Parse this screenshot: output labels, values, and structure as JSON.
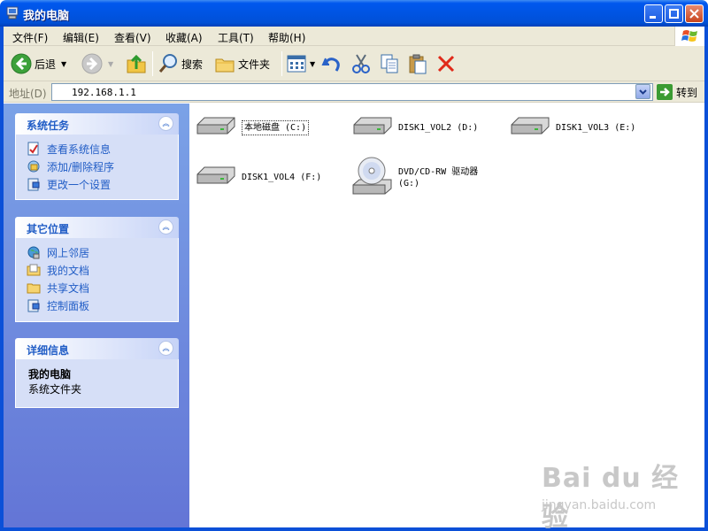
{
  "window": {
    "title": "我的电脑"
  },
  "menu": [
    {
      "label": "文件(F)"
    },
    {
      "label": "编辑(E)"
    },
    {
      "label": "查看(V)"
    },
    {
      "label": "收藏(A)"
    },
    {
      "label": "工具(T)"
    },
    {
      "label": "帮助(H)"
    }
  ],
  "toolbar": {
    "back_label": "后退",
    "search_label": "搜索",
    "folders_label": "文件夹"
  },
  "address": {
    "label": "地址(D)",
    "value": "192.168.1.1",
    "go_label": "转到"
  },
  "task_pane": {
    "system_tasks": {
      "title": "系统任务",
      "items": [
        {
          "label": "查看系统信息",
          "icon": "system-info-icon"
        },
        {
          "label": "添加/删除程序",
          "icon": "add-remove-programs-icon"
        },
        {
          "label": "更改一个设置",
          "icon": "control-panel-icon"
        }
      ]
    },
    "other_places": {
      "title": "其它位置",
      "items": [
        {
          "label": "网上邻居",
          "icon": "network-places-icon"
        },
        {
          "label": "我的文档",
          "icon": "my-documents-icon"
        },
        {
          "label": "共享文档",
          "icon": "shared-folder-icon"
        },
        {
          "label": "控制面板",
          "icon": "control-panel-icon"
        }
      ]
    },
    "details": {
      "title": "详细信息",
      "name": "我的电脑",
      "description": "系统文件夹"
    }
  },
  "drives": [
    {
      "label": "本地磁盘 (C:)",
      "icon": "hard-disk-icon"
    },
    {
      "label": "DISK1_VOL2 (D:)",
      "icon": "hard-disk-icon"
    },
    {
      "label": "DISK1_VOL3 (E:)",
      "icon": "hard-disk-icon"
    },
    {
      "label": "DISK1_VOL4 (F:)",
      "icon": "hard-disk-icon"
    },
    {
      "label_line1": "DVD/CD-RW 驱动器",
      "label_line2": "(G:)",
      "icon": "dvd-drive-icon"
    }
  ],
  "watermark": {
    "main": "Bai du 经验",
    "sub": "jingyan.baidu.com"
  },
  "colors": {
    "titlebar": "#0054e3",
    "taskpane": "#7ba2e7",
    "panel_text": "#215dc6",
    "panel_body": "#d6dff7"
  }
}
